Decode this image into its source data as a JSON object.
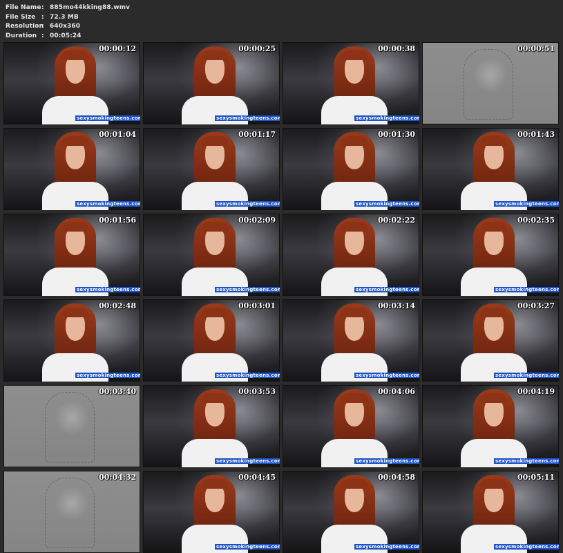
{
  "file_info": {
    "name_label": "File Name",
    "name_value": "885mo44kking88.wmv",
    "size_label": "File Size",
    "size_value": "72.3 MB",
    "resolution_label": "Resolution",
    "resolution_value": "640x360",
    "duration_label": "Duration",
    "duration_value": "00:05:24",
    "separator": ":"
  },
  "thumbnails": [
    {
      "time": "00:00:12",
      "watermark": "sexysmokingteens.com",
      "style": "photo"
    },
    {
      "time": "00:00:25",
      "watermark": "sexysmokingteens.com",
      "style": "photo"
    },
    {
      "time": "00:00:38",
      "watermark": "sexysmokingteens.com",
      "style": "photo"
    },
    {
      "time": "00:00:51",
      "watermark": "",
      "style": "gray"
    },
    {
      "time": "00:01:04",
      "watermark": "sexysmokingteens.com",
      "style": "photo"
    },
    {
      "time": "00:01:17",
      "watermark": "sexysmokingteens.com",
      "style": "photo"
    },
    {
      "time": "00:01:30",
      "watermark": "sexysmokingteens.com",
      "style": "photo"
    },
    {
      "time": "00:01:43",
      "watermark": "sexysmokingteens.com",
      "style": "photo"
    },
    {
      "time": "00:01:56",
      "watermark": "sexysmokingteens.com",
      "style": "photo"
    },
    {
      "time": "00:02:09",
      "watermark": "sexysmokingteens.com",
      "style": "photo"
    },
    {
      "time": "00:02:22",
      "watermark": "sexysmokingteens.com",
      "style": "photo"
    },
    {
      "time": "00:02:35",
      "watermark": "sexysmokingteens.com",
      "style": "photo"
    },
    {
      "time": "00:02:48",
      "watermark": "sexysmokingteens.com",
      "style": "photo"
    },
    {
      "time": "00:03:01",
      "watermark": "sexysmokingteens.com",
      "style": "photo"
    },
    {
      "time": "00:03:14",
      "watermark": "sexysmokingteens.com",
      "style": "photo"
    },
    {
      "time": "00:03:27",
      "watermark": "sexysmokingteens.com",
      "style": "photo"
    },
    {
      "time": "00:03:40",
      "watermark": "",
      "style": "gray"
    },
    {
      "time": "00:03:53",
      "watermark": "sexysmokingteens.com",
      "style": "photo"
    },
    {
      "time": "00:04:06",
      "watermark": "sexysmokingteens.com",
      "style": "photo"
    },
    {
      "time": "00:04:19",
      "watermark": "sexysmokingteens.com",
      "style": "photo"
    },
    {
      "time": "00:04:32",
      "watermark": "",
      "style": "gray"
    },
    {
      "time": "00:04:45",
      "watermark": "sexysmokingteens.com",
      "style": "photo"
    },
    {
      "time": "00:04:58",
      "watermark": "sexysmokingteens.com",
      "style": "photo"
    },
    {
      "time": "00:05:11",
      "watermark": "sexysmokingteens.com",
      "style": "photo"
    }
  ]
}
